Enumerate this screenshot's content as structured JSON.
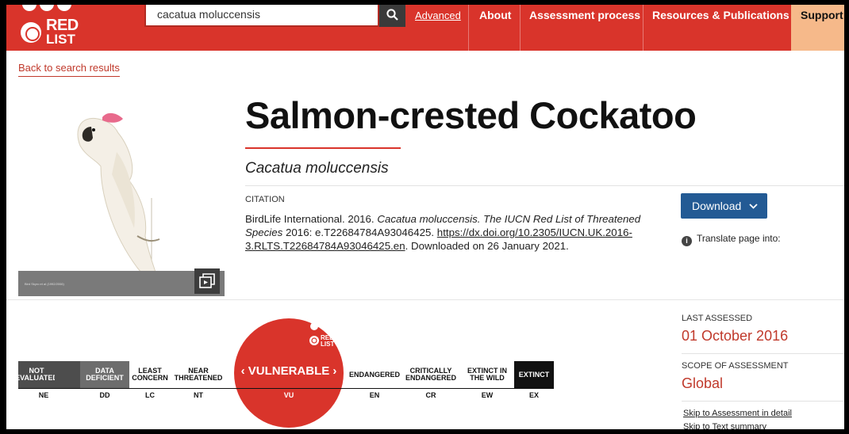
{
  "header": {
    "logo_top": "RED",
    "logo_bottom": "LIST",
    "logo_badge": "IUCN",
    "search_value": "cacatua moluccensis",
    "advanced": "Advanced",
    "nav": [
      "About",
      "Assessment process",
      "Resources & Publications"
    ],
    "support": "Support u"
  },
  "back_link": "Back to search results",
  "image": {
    "caption": "Bird Skyro et al (1992/2006)"
  },
  "species": {
    "common_name": "Salmon-crested Cockatoo",
    "scientific_name": "Cacatua moluccensis"
  },
  "citation": {
    "label": "CITATION",
    "prefix": "BirdLife International. 2016.",
    "italic": "Cacatua moluccensis. The IUCN Red List of Threatened Species",
    "mid": "2016: e.T22684784A93046425.",
    "doi": "https://dx.doi.org/10.2305/IUCN.UK.2016-3.RLTS.T22684784A93046425.en",
    "suffix": ". Downloaded on 26 January 2021."
  },
  "download_label": "Download",
  "translate_label": "Translate page into:",
  "categories": [
    {
      "label": "NOT EVALUATED",
      "code": "NE"
    },
    {
      "label": "DATA DEFICIENT",
      "code": "DD"
    },
    {
      "label": "LEAST CONCERN",
      "code": "LC"
    },
    {
      "label": "NEAR THREATENED",
      "code": "NT"
    },
    {
      "label": "VULNERABLE",
      "code": "VU"
    },
    {
      "label": "ENDANGERED",
      "code": "EN"
    },
    {
      "label": "CRITICALLY ENDANGERED",
      "code": "CR"
    },
    {
      "label": "EXTINCT IN THE WILD",
      "code": "EW"
    },
    {
      "label": "EXTINCT",
      "code": "EX"
    }
  ],
  "current_category": "VU",
  "assessment": {
    "last_assessed_label": "LAST ASSESSED",
    "last_assessed": "01 October 2016",
    "scope_label": "SCOPE OF ASSESSMENT",
    "scope": "Global",
    "skip1": "Skip to Assessment in detail",
    "skip2": "Skip to Text summary"
  },
  "colors": {
    "brand_red": "#d9342b",
    "download_blue": "#235a94",
    "support_bg": "#f6b98a"
  }
}
